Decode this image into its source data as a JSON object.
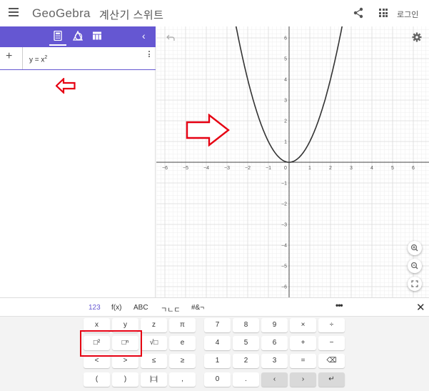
{
  "header": {
    "logo": "GeoGebra",
    "title": "계산기 스위트",
    "login": "로그인",
    "icons": [
      "menu-icon",
      "share-icon",
      "apps-grid-icon"
    ]
  },
  "algebra": {
    "toolbar_icons": [
      "calculator-icon",
      "geometry-icon",
      "table-icon"
    ],
    "collapse": "‹",
    "add": "+",
    "expression": {
      "lhs": "y = x",
      "exponent": "2"
    }
  },
  "graph": {
    "x_ticks": [
      "−6",
      "−5",
      "−4",
      "−3",
      "−2",
      "−1",
      "0",
      "1",
      "2",
      "3",
      "4",
      "5",
      "6"
    ],
    "y_ticks_pos": [
      "6",
      "5",
      "4",
      "3",
      "2",
      "1"
    ],
    "y_ticks_neg": [
      "−1",
      "−2",
      "−3",
      "−4",
      "−5",
      "−6"
    ],
    "function": "y = x^2",
    "curve_color": "#333333",
    "grid_color": "#e6e6e6"
  },
  "keyboard": {
    "tabs": [
      "123",
      "f(x)",
      "ABC",
      "ㄱㄴㄷ",
      "#&¬"
    ],
    "more": "•••",
    "close": "✕",
    "rows": [
      [
        "x",
        "y",
        "z",
        "π",
        "7",
        "8",
        "9",
        "×",
        "÷"
      ],
      [
        "□²",
        "□ⁿ",
        "√□",
        "e",
        "4",
        "5",
        "6",
        "+",
        "−"
      ],
      [
        "<",
        ">",
        "≤",
        "≥",
        "1",
        "2",
        "3",
        "=",
        "⌫"
      ],
      [
        "(",
        ")",
        "|□|",
        ",",
        "0",
        ".",
        "‹",
        "›",
        "↵"
      ]
    ]
  },
  "accent_color": "#6557d2",
  "annotation_color": "#e60012"
}
